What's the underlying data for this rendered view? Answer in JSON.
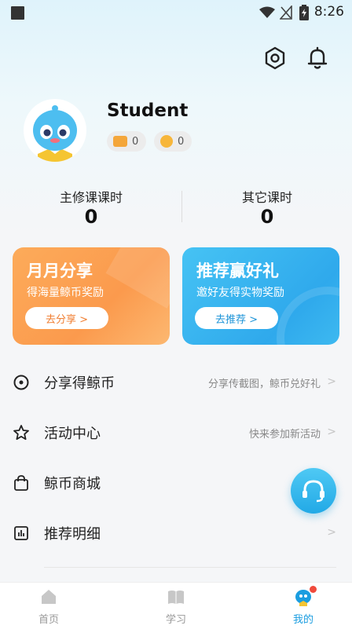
{
  "status_bar": {
    "time": "8:26"
  },
  "profile": {
    "name": "Student",
    "coin_card_count": "0",
    "coin_count": "0"
  },
  "hours": {
    "main_label": "主修课课时",
    "main_value": "0",
    "other_label": "其它课时",
    "other_value": "0"
  },
  "promo": [
    {
      "title": "月月分享",
      "subtitle": "得海量鲸币奖励",
      "button": "去分享 >"
    },
    {
      "title": "推荐赢好礼",
      "subtitle": "邀好友得实物奖励",
      "button": "去推荐 >"
    }
  ],
  "menu": [
    {
      "label": "分享得鲸币",
      "hint": "分享传截图，鲸币兑好礼"
    },
    {
      "label": "活动中心",
      "hint": "快来参加新活动"
    },
    {
      "label": "鲸币商城",
      "hint": ""
    },
    {
      "label": "推荐明细",
      "hint": ""
    }
  ],
  "tabs": [
    {
      "label": "首页",
      "active": false
    },
    {
      "label": "学习",
      "active": false
    },
    {
      "label": "我的",
      "active": true
    }
  ],
  "colors": {
    "accent_blue": "#1a9de0",
    "orange_card": "#fb9b4f",
    "blue_card": "#35b3ef",
    "badge_red": "#f04a3c"
  }
}
